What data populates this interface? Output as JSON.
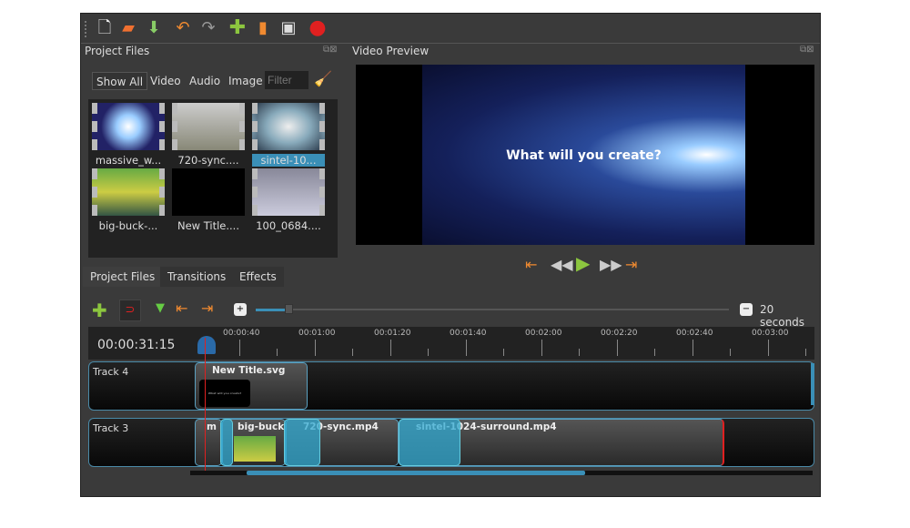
{
  "toolbar": {
    "icons": [
      "new-project-icon",
      "open-project-icon",
      "save-project-icon",
      "undo-icon",
      "redo-icon",
      "import-files-icon",
      "choose-profile-icon",
      "fullscreen-icon",
      "export-video-icon"
    ]
  },
  "project_files": {
    "title": "Project Files",
    "filters": [
      "Show All",
      "Video",
      "Audio",
      "Image"
    ],
    "filter_placeholder": "Filter",
    "items": [
      {
        "label": "massive_w...",
        "selected": false
      },
      {
        "label": "720-sync....",
        "selected": false
      },
      {
        "label": "sintel-10...",
        "selected": true
      },
      {
        "label": "big-buck-...",
        "selected": false
      },
      {
        "label": "New Title....",
        "selected": false
      },
      {
        "label": "100_0684....",
        "selected": false
      }
    ]
  },
  "tabs": [
    "Project Files",
    "Transitions",
    "Effects"
  ],
  "video_preview": {
    "title": "Video Preview",
    "overlay_text": "What will you create?"
  },
  "timeline": {
    "zoom_label": "20 seconds",
    "timecode": "00:00:31:15",
    "ruler": [
      "00:00:40",
      "00:01:00",
      "00:01:20",
      "00:01:40",
      "00:02:00",
      "00:02:20",
      "00:02:40",
      "00:03:00"
    ],
    "tracks": [
      {
        "name": "Track 4",
        "clips": [
          "New Title.svg"
        ]
      },
      {
        "name": "Track 3",
        "clips": [
          "m",
          "big-buck-",
          "720-sync.mp4",
          "sintel-1024-surround.mp4"
        ]
      }
    ],
    "title_clip_text": "What will you create?"
  },
  "colors": {
    "accent": "#3a8fb7",
    "playhead": "#e02020",
    "add": "#8cc63f",
    "orange": "#f08a30"
  }
}
